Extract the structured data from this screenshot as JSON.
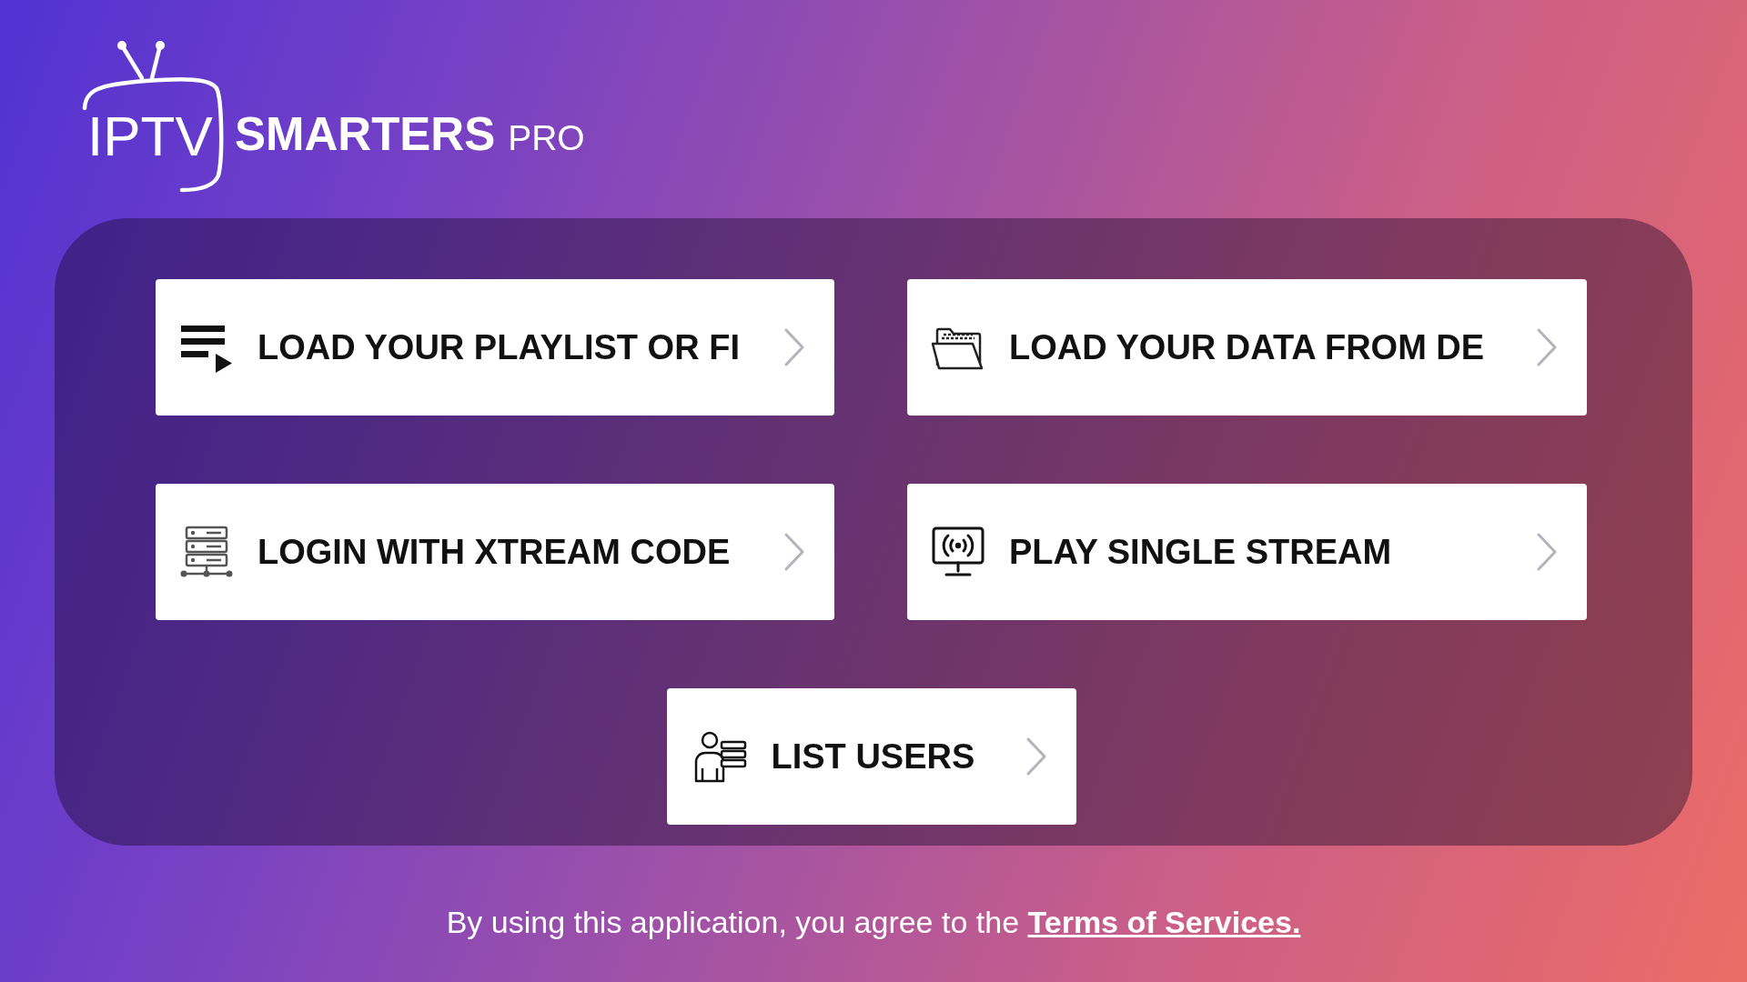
{
  "logo": {
    "mark_text": "IPTV",
    "name": "SMARTERS",
    "edition": "PRO"
  },
  "menu": [
    {
      "kind": "playlist",
      "label": "LOAD YOUR PLAYLIST OR FI"
    },
    {
      "kind": "device_data",
      "label": "LOAD YOUR DATA FROM DE"
    },
    {
      "kind": "xtream_login",
      "label": "LOGIN WITH XTREAM CODE"
    },
    {
      "kind": "single_stream",
      "label": "PLAY SINGLE STREAM"
    },
    {
      "kind": "list_users",
      "label": "LIST USERS"
    }
  ],
  "footer": {
    "text": "By using this application, you agree to the",
    "link": "Terms of Services."
  }
}
